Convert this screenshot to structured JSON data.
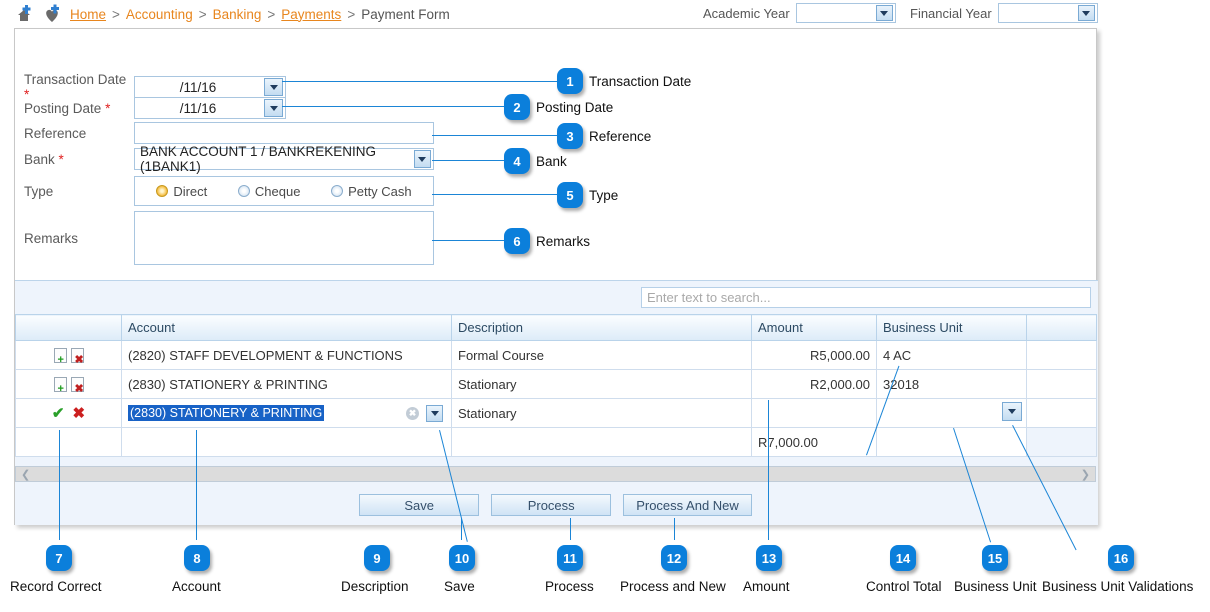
{
  "breadcrumb": {
    "home_icon": "home-plus-icon",
    "favorite_icon": "heart-plus-icon",
    "items": [
      {
        "label": "Home",
        "link": true
      },
      {
        "label": "Accounting",
        "link": false
      },
      {
        "label": "Banking",
        "link": false
      },
      {
        "label": "Payments",
        "link": true
      }
    ],
    "separator": ">",
    "current": "Payment Form"
  },
  "header": {
    "academic_year_label": "Academic Year",
    "academic_year_value": "",
    "financial_year_label": "Financial Year",
    "financial_year_value": "",
    "dropdown_icon": "chevron-down-icon"
  },
  "form": {
    "transaction_date": {
      "label": "Transaction Date",
      "required": "*",
      "value": "/11/16"
    },
    "posting_date": {
      "label": "Posting Date",
      "required": "*",
      "value": "/11/16"
    },
    "reference": {
      "label": "Reference",
      "value": ""
    },
    "bank": {
      "label": "Bank",
      "required": "*",
      "value": "BANK ACCOUNT 1 / BANKREKENING (1BANK1)"
    },
    "type": {
      "label": "Type",
      "options": [
        {
          "label": "Direct",
          "selected": true
        },
        {
          "label": "Cheque",
          "selected": false
        },
        {
          "label": "Petty Cash",
          "selected": false
        }
      ]
    },
    "remarks": {
      "label": "Remarks",
      "value": ""
    }
  },
  "grid": {
    "search_placeholder": "Enter text to search...",
    "search_value": "",
    "columns": [
      "",
      "Account",
      "Description",
      "Amount",
      "Business Unit",
      ""
    ],
    "rows": [
      {
        "account": "(2820) STAFF DEVELOPMENT & FUNCTIONS",
        "description": "Formal Course",
        "amount": "R5,000.00",
        "business_unit": "4 AC",
        "add_icon": "document-add-icon",
        "delete_icon": "document-delete-icon"
      },
      {
        "account": "(2830) STATIONERY & PRINTING",
        "description": "Stationary",
        "amount": "R2,000.00",
        "business_unit": "32018",
        "add_icon": "document-add-icon",
        "delete_icon": "document-delete-icon"
      }
    ],
    "edit_row": {
      "account": "(2830) STATIONERY & PRINTING",
      "description": "Stationary",
      "amount": "",
      "business_unit": "",
      "confirm_icon": "green-check-icon",
      "cancel_icon": "red-cross-icon",
      "clear_icon": "clear-circle-icon",
      "dropdown_icon": "chevron-down-icon"
    },
    "total": {
      "amount": "R7,000.00"
    },
    "scroll_left_icon": "chevron-left-icon",
    "scroll_right_icon": "chevron-right-icon"
  },
  "buttons": {
    "save": "Save",
    "process": "Process",
    "process_and_new": "Process And New"
  },
  "callouts": [
    {
      "n": "1",
      "label": "Transaction Date"
    },
    {
      "n": "2",
      "label": "Posting Date"
    },
    {
      "n": "3",
      "label": "Reference"
    },
    {
      "n": "4",
      "label": "Bank"
    },
    {
      "n": "5",
      "label": "Type"
    },
    {
      "n": "6",
      "label": "Remarks"
    },
    {
      "n": "7",
      "label": "Record Correct"
    },
    {
      "n": "8",
      "label": "Account"
    },
    {
      "n": "9",
      "label": "Description"
    },
    {
      "n": "10",
      "label": "Save"
    },
    {
      "n": "11",
      "label": "Process"
    },
    {
      "n": "12",
      "label": "Process and New"
    },
    {
      "n": "13",
      "label": "Amount"
    },
    {
      "n": "14",
      "label": "Control Total"
    },
    {
      "n": "15",
      "label": "Business Unit"
    },
    {
      "n": "16",
      "label": "Business Unit Validations"
    }
  ],
  "colors": {
    "callout_blue": "#0b7fdb",
    "breadcrumb_orange": "#e8861e",
    "selection_blue": "#1862c6",
    "grid_header_blue": "#dcebf8"
  }
}
